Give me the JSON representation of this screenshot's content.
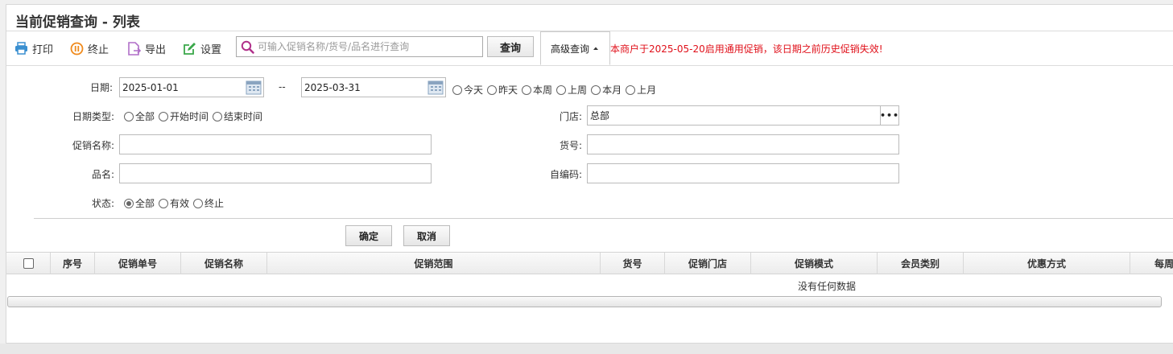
{
  "page": {
    "title": "当前促销查询 - 列表"
  },
  "toolbar": {
    "print_label": "打印",
    "stop_label": "终止",
    "export_label": "导出",
    "settings_label": "设置",
    "search_placeholder": "可输入促销名称/货号/品名进行查询",
    "search_value": "",
    "query_label": "查询",
    "advanced_label": "高级查询",
    "notice": "本商户于2025-05-20启用通用促销，该日期之前历史促销失效!"
  },
  "filters": {
    "date_label": "日期:",
    "date_from": "2025-01-01",
    "date_sep": "--",
    "date_to": "2025-03-31",
    "date_quick": [
      "今天",
      "昨天",
      "本周",
      "上周",
      "本月",
      "上月"
    ],
    "date_type_label": "日期类型:",
    "date_type_options": [
      "全部",
      "开始时间",
      "结束时间"
    ],
    "store_label": "门店:",
    "store_value": "总部",
    "store_more": "•••",
    "promo_name_label": "促销名称:",
    "promo_name_value": "",
    "item_no_label": "货号:",
    "item_no_value": "",
    "product_name_label": "品名:",
    "product_name_value": "",
    "self_code_label": "自编码:",
    "self_code_value": "",
    "status_label": "状态:",
    "status_options": [
      "全部",
      "有效",
      "终止"
    ],
    "status_selected": "全部",
    "confirm_label": "确定",
    "cancel_label": "取消"
  },
  "grid": {
    "columns": [
      "序号",
      "促销单号",
      "促销名称",
      "促销范围",
      "货号",
      "促销门店",
      "促销模式",
      "会员类别",
      "优惠方式",
      "每周"
    ],
    "empty_text": "没有任何数据"
  },
  "colors": {
    "notice": "#e0101a",
    "print_icon": "#3a8fd0",
    "stop_icon": "#f08a1c",
    "export_icon": "#b06fc8",
    "settings_icon": "#3aa84a",
    "search_icon": "#b0308a"
  }
}
